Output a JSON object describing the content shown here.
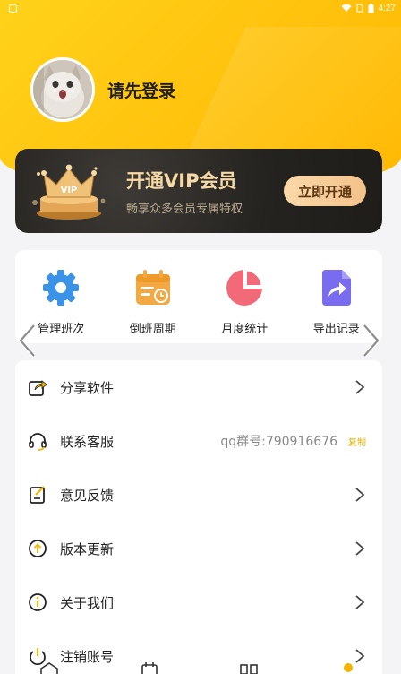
{
  "status": {
    "time": "4:27"
  },
  "profile": {
    "username": "请先登录"
  },
  "vip": {
    "title": "开通VIP会员",
    "subtitle": "畅享众多会员专属特权",
    "button": "立即开通",
    "badge": "VIP"
  },
  "tools": [
    {
      "label": "管理班次",
      "icon": "gear-icon"
    },
    {
      "label": "倒班周期",
      "icon": "calendar-icon"
    },
    {
      "label": "月度统计",
      "icon": "pie-chart-icon"
    },
    {
      "label": "导出记录",
      "icon": "export-icon"
    }
  ],
  "menu": {
    "share": "分享软件",
    "service": "联系客服",
    "qq": "qq群号:790916676",
    "copy": "复制",
    "feedback": "意见反馈",
    "update": "版本更新",
    "about": "关于我们",
    "logout": "注销账号"
  },
  "colors": {
    "accent": "#ffc412",
    "vip_bg": "#25231f",
    "vip_gold": "#f7d9a5"
  }
}
